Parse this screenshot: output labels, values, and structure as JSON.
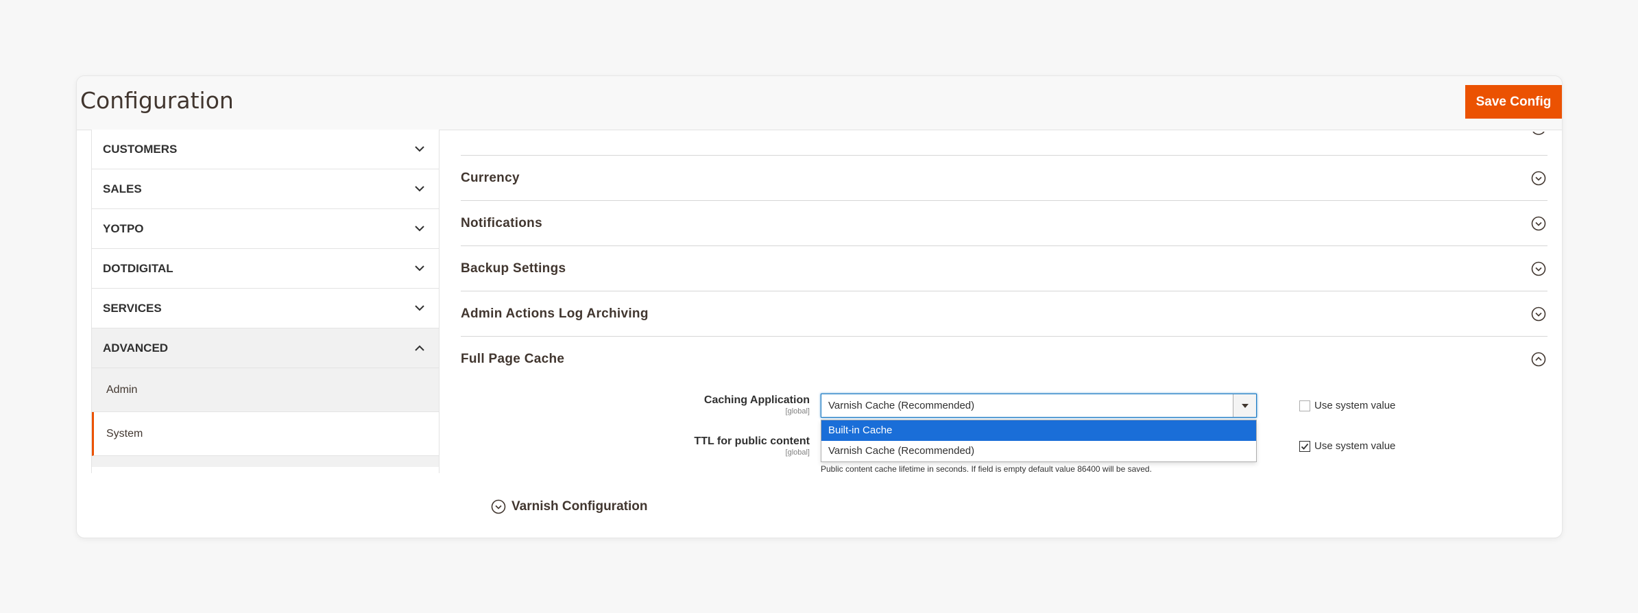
{
  "header": {
    "title": "Configuration",
    "save_label": "Save Config"
  },
  "sidebar": {
    "sections": [
      {
        "label": "CUSTOMERS",
        "expanded": false
      },
      {
        "label": "SALES",
        "expanded": false
      },
      {
        "label": "YOTPO",
        "expanded": false
      },
      {
        "label": "DOTDIGITAL",
        "expanded": false
      },
      {
        "label": "SERVICES",
        "expanded": false
      },
      {
        "label": "ADVANCED",
        "expanded": true
      }
    ],
    "advanced_items": [
      {
        "label": "Admin",
        "current": false
      },
      {
        "label": "System",
        "current": true
      }
    ]
  },
  "main": {
    "sections": [
      {
        "label": "Currency",
        "expanded": false
      },
      {
        "label": "Notifications",
        "expanded": false
      },
      {
        "label": "Backup Settings",
        "expanded": false
      },
      {
        "label": "Admin Actions Log Archiving",
        "expanded": false
      },
      {
        "label": "Full Page Cache",
        "expanded": true
      }
    ],
    "fpc": {
      "caching_label": "Caching Application",
      "caching_scope": "[global]",
      "caching_value": "Varnish Cache (Recommended)",
      "options": [
        "Built-in Cache",
        "Varnish Cache (Recommended)"
      ],
      "highlighted_option": "Built-in Cache",
      "use_system_label": "Use system value",
      "caching_use_system": false,
      "ttl_label": "TTL for public content",
      "ttl_scope": "[global]",
      "ttl_use_system": true,
      "ttl_note": "Public content cache lifetime in seconds. If field is empty default value 86400 will be saved.",
      "varnish_group": "Varnish Configuration"
    }
  },
  "colors": {
    "accent": "#eb5202",
    "focus": "#1979c3",
    "option_highlight": "#1a6ed8"
  }
}
